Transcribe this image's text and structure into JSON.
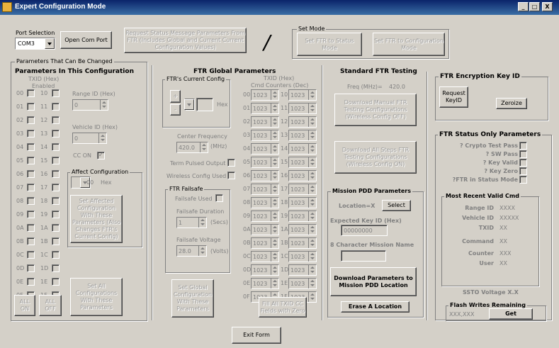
{
  "window": {
    "title": "Expert Configuration Mode",
    "min": "_",
    "max": "□",
    "close": "X"
  },
  "port": {
    "label": "Port Selection",
    "value": "COM3",
    "open_btn": "Open Com Port"
  },
  "request_btn": "Request Status Message Parameters From FTR (Includes Global and Current Current Configuration Values)",
  "slash": "/",
  "setmode": {
    "title": "Set Mode",
    "status_btn": "Set FTR to Status Mode",
    "config_btn": "Set FTR to Configuration Mode"
  },
  "params": {
    "group_title": "Parameters That Can Be Changed",
    "heading": "Parameters In This Configuration",
    "txid_header": "TXID (Hex)",
    "enabled_header": "Enabled",
    "txids_a": [
      "00",
      "01",
      "02",
      "03",
      "04",
      "05",
      "06",
      "07",
      "08",
      "09",
      "0A",
      "0B",
      "0C",
      "0D",
      "0E",
      "0F"
    ],
    "txids_b": [
      "10",
      "11",
      "12",
      "13",
      "14",
      "15",
      "16",
      "17",
      "18",
      "19",
      "1A",
      "1B",
      "1C",
      "1D",
      "1E",
      "1F"
    ],
    "range_label": "Range ID (Hex)",
    "range_value": "0",
    "vehicle_label": "Vehicle ID (Hex)",
    "vehicle_value": "0",
    "cc_on_label": "CC ON",
    "cc_on_check": "✓",
    "affect_title": "Affect Configuration",
    "affect_value": "00",
    "affect_hex": "Hex",
    "set_affected_btn": "Set Affected Configuration With These Parameters (Also Changes FTR's Current Config)",
    "set_all_btn": "Set All Configurations With These Parameters",
    "all_on": "ALL ON",
    "all_off": "ALL OFF"
  },
  "global": {
    "heading": "FTR Global Parameters",
    "current_config_title": "FTR's Current Config",
    "plus": "+",
    "minus": "-",
    "hex": "Hex",
    "center_freq_label": "Center Frequency",
    "center_freq_value": "420.0",
    "mhz": "(MHz)",
    "term_pulsed_label": "Term Pulsed Output",
    "wireless_used_label": "Wireless Config Used",
    "failsafe_title": "FTR Failsafe",
    "failsafe_used_label": "Failsafe Used",
    "failsafe_dur_label": "Failsafe Duration",
    "failsafe_dur_value": "1",
    "secs": "(Secs)",
    "failsafe_volt_label": "Failsafe Voltage",
    "failsafe_volt_value": "28.0",
    "volts": "(Volts)",
    "set_global_btn": "Set Global Configuration With These Parameters",
    "txid_header": "TXID (Hex)",
    "cmd_header": "Cmd Counters (Dec)",
    "counters_a": [
      {
        "id": "00",
        "v": "1023"
      },
      {
        "id": "01",
        "v": "1023"
      },
      {
        "id": "02",
        "v": "1023"
      },
      {
        "id": "03",
        "v": "1023"
      },
      {
        "id": "04",
        "v": "1023"
      },
      {
        "id": "05",
        "v": "1023"
      },
      {
        "id": "06",
        "v": "1023"
      },
      {
        "id": "07",
        "v": "1023"
      },
      {
        "id": "08",
        "v": "1023"
      },
      {
        "id": "09",
        "v": "1023"
      },
      {
        "id": "0A",
        "v": "1023"
      },
      {
        "id": "0B",
        "v": "1023"
      },
      {
        "id": "0C",
        "v": "1023"
      },
      {
        "id": "0D",
        "v": "1023"
      },
      {
        "id": "0E",
        "v": "1023"
      },
      {
        "id": "0F",
        "v": "1023"
      }
    ],
    "counters_b": [
      {
        "id": "10",
        "v": "1023"
      },
      {
        "id": "11",
        "v": "1023"
      },
      {
        "id": "12",
        "v": "1023"
      },
      {
        "id": "13",
        "v": "1023"
      },
      {
        "id": "14",
        "v": "1023"
      },
      {
        "id": "15",
        "v": "1023"
      },
      {
        "id": "16",
        "v": "1023"
      },
      {
        "id": "17",
        "v": "1023"
      },
      {
        "id": "18",
        "v": "1023"
      },
      {
        "id": "19",
        "v": "1023"
      },
      {
        "id": "1A",
        "v": "1023"
      },
      {
        "id": "1B",
        "v": "1023"
      },
      {
        "id": "1C",
        "v": "1023"
      },
      {
        "id": "1D",
        "v": "1023"
      },
      {
        "id": "1E",
        "v": "1023"
      },
      {
        "id": "1F",
        "v": "1023"
      }
    ],
    "fill_btn": "Fill All TXID CC Fields with Zero"
  },
  "testing": {
    "heading": "Standard FTR Testing",
    "freq_label": "Freq (MHz)=",
    "freq_value": "420.0",
    "download_manual_btn": "Download Manual FTR Testing Configurations (Wireless Config OFF)",
    "download_all_btn": "Download All Steps FTR Testing Configurations (Wireless Config ON)"
  },
  "mission": {
    "title": "Mission PDD Parameters",
    "location_label": "Location=X",
    "select_btn": "Select",
    "expected_key_label": "Expected Key ID (Hex)",
    "expected_key_value": "00000000",
    "mission_name_label": "8 Character Mission Name",
    "mission_name_value": "",
    "download_btn": "Download Parameters to Mission PDD Location",
    "erase_btn": "Erase A Location"
  },
  "encryption": {
    "title": "FTR Encryption Key ID",
    "request_btn": "Request KeyID",
    "zeroize_btn": "Zeroize"
  },
  "status_only": {
    "title": "FTR Status Only Parameters",
    "items": [
      "? Crypto Test Pass",
      "? SW Pass",
      "? Key Valid",
      "? Key Zero",
      "?FTR in Status Mode"
    ],
    "recent_title": "Most Recent Valid Cmd",
    "recent": [
      {
        "label": "Range ID",
        "value": "XXXX"
      },
      {
        "label": "Vehicle ID",
        "value": "XXXXX"
      },
      {
        "label": "TXID",
        "value": "XX"
      },
      {
        "label": "Command",
        "value": "XX"
      },
      {
        "label": "Counter",
        "value": "XXX"
      },
      {
        "label": "User",
        "value": "XX"
      }
    ],
    "ssto_label": "SSTO Voltage X.X",
    "flash_title": "Flash Writes Remaining",
    "flash_value": "XXX,XXX",
    "get_btn": "Get"
  },
  "exit_btn": "Exit Form"
}
